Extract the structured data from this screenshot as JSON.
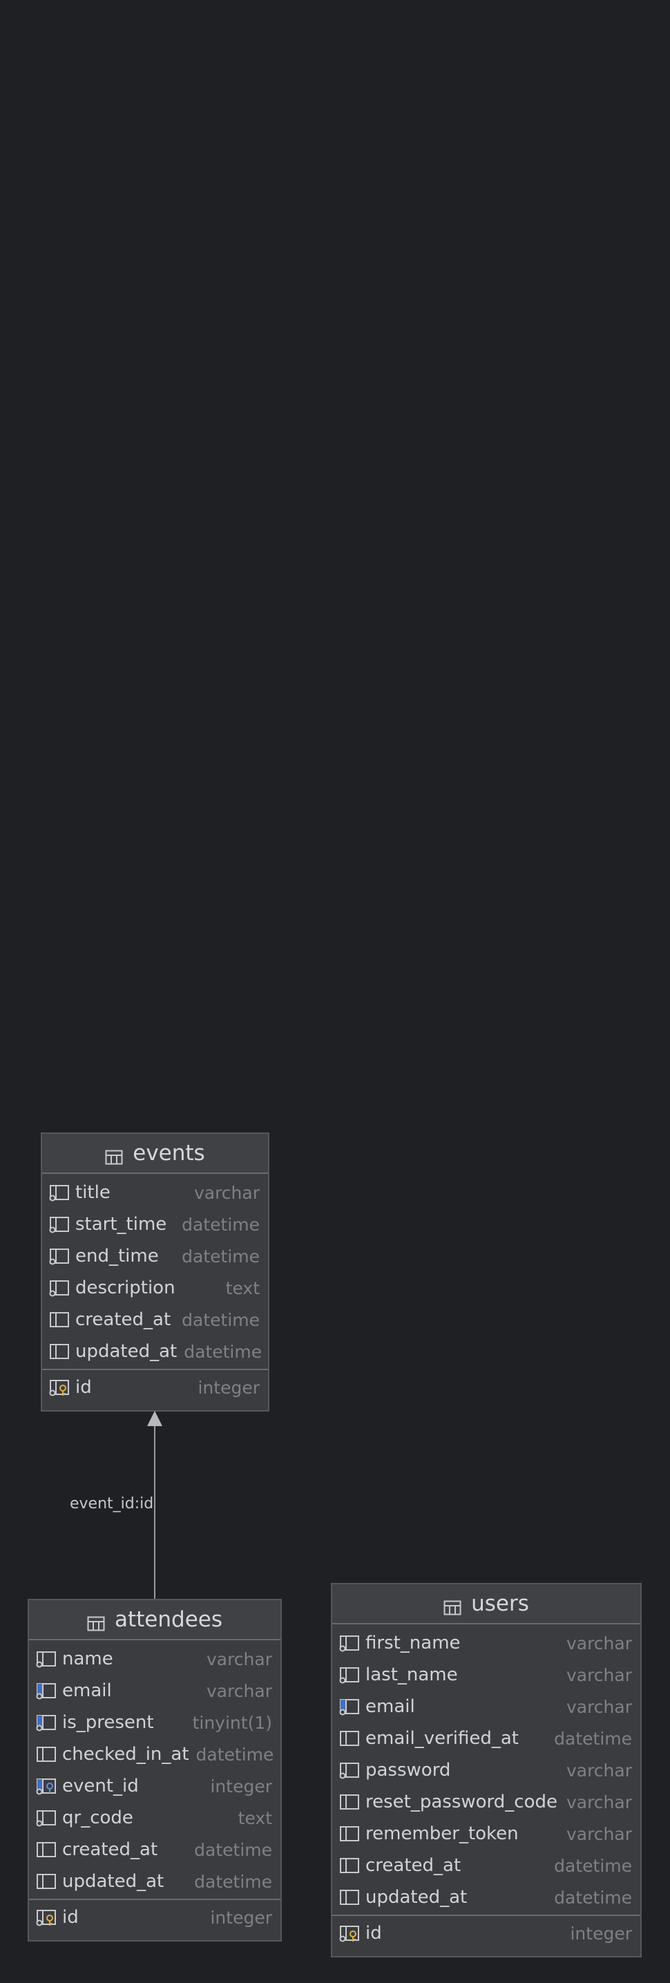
{
  "diagram": {
    "tables": [
      {
        "key": "events",
        "name": "events",
        "columns": [
          {
            "name": "title",
            "type": "varchar",
            "icon": "column-icon-not-null"
          },
          {
            "name": "start_time",
            "type": "datetime",
            "icon": "column-icon-not-null"
          },
          {
            "name": "end_time",
            "type": "datetime",
            "icon": "column-icon-not-null"
          },
          {
            "name": "description",
            "type": "text",
            "icon": "column-icon-not-null"
          },
          {
            "name": "created_at",
            "type": "datetime",
            "icon": "column-icon"
          },
          {
            "name": "updated_at",
            "type": "datetime",
            "icon": "column-icon"
          }
        ],
        "keys": [
          {
            "name": "id",
            "type": "integer",
            "icon": "primary-key-icon"
          }
        ]
      },
      {
        "key": "attendees",
        "name": "attendees",
        "columns": [
          {
            "name": "name",
            "type": "varchar",
            "icon": "column-icon-not-null"
          },
          {
            "name": "email",
            "type": "varchar",
            "icon": "indexed-column-icon"
          },
          {
            "name": "is_present",
            "type": "tinyint(1)",
            "icon": "indexed-column-icon"
          },
          {
            "name": "checked_in_at",
            "type": "datetime",
            "icon": "column-icon"
          },
          {
            "name": "event_id",
            "type": "integer",
            "icon": "foreign-key-icon"
          },
          {
            "name": "qr_code",
            "type": "text",
            "icon": "column-icon-not-null"
          },
          {
            "name": "created_at",
            "type": "datetime",
            "icon": "column-icon"
          },
          {
            "name": "updated_at",
            "type": "datetime",
            "icon": "column-icon"
          }
        ],
        "keys": [
          {
            "name": "id",
            "type": "integer",
            "icon": "primary-key-icon"
          }
        ]
      },
      {
        "key": "users",
        "name": "users",
        "columns": [
          {
            "name": "first_name",
            "type": "varchar",
            "icon": "column-icon-not-null"
          },
          {
            "name": "last_name",
            "type": "varchar",
            "icon": "column-icon-not-null"
          },
          {
            "name": "email",
            "type": "varchar",
            "icon": "indexed-column-icon"
          },
          {
            "name": "email_verified_at",
            "type": "datetime",
            "icon": "column-icon"
          },
          {
            "name": "password",
            "type": "varchar",
            "icon": "column-icon-not-null"
          },
          {
            "name": "reset_password_code",
            "type": "varchar",
            "icon": "column-icon"
          },
          {
            "name": "remember_token",
            "type": "varchar",
            "icon": "column-icon"
          },
          {
            "name": "created_at",
            "type": "datetime",
            "icon": "column-icon"
          },
          {
            "name": "updated_at",
            "type": "datetime",
            "icon": "column-icon"
          }
        ],
        "keys": [
          {
            "name": "id",
            "type": "integer",
            "icon": "primary-key-icon"
          }
        ]
      }
    ],
    "relations": [
      {
        "from": "attendees",
        "to": "events",
        "label": "event_id:id"
      }
    ],
    "colors": {
      "background": "#1f2024",
      "table_body": "#3b3c40",
      "table_header": "#404145",
      "column_name": "#d2d3d7",
      "column_type": "#7f8086",
      "index_accent": "#4a7fd6",
      "key_accent": "#e0b040"
    }
  }
}
